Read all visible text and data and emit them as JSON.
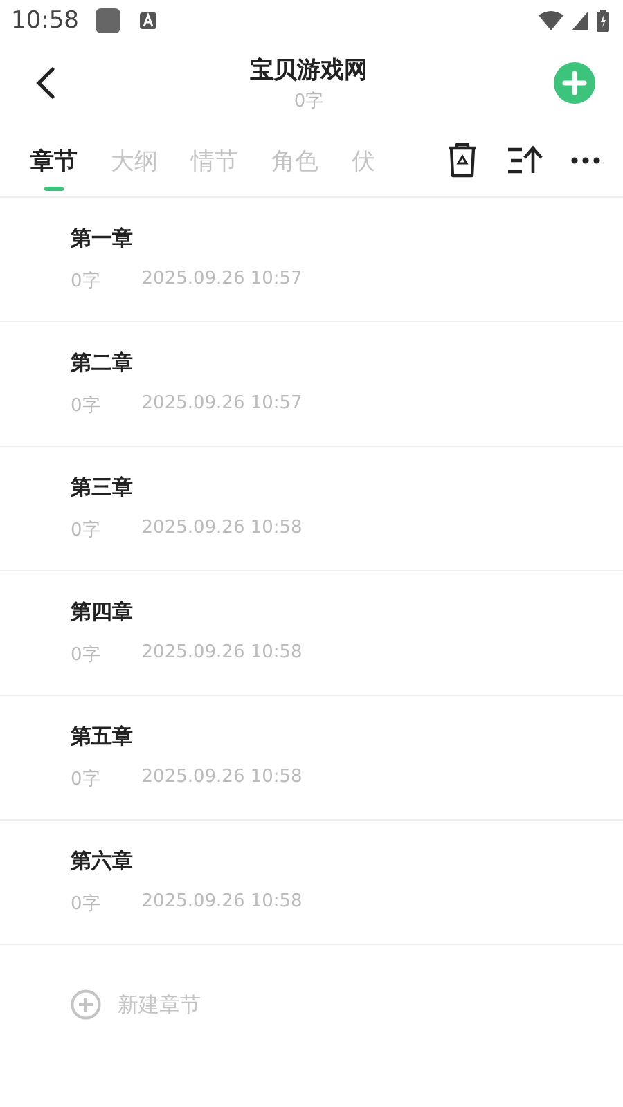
{
  "status_bar": {
    "time": "10:58"
  },
  "header": {
    "title": "宝贝游戏网",
    "subtitle": "0字"
  },
  "tabs": [
    {
      "label": "章节",
      "selected": true
    },
    {
      "label": "大纲",
      "selected": false
    },
    {
      "label": "情节",
      "selected": false
    },
    {
      "label": "角色",
      "selected": false
    },
    {
      "label": "伏",
      "selected": false
    }
  ],
  "chapters": [
    {
      "title": "第一章",
      "words": "0字",
      "date": "2025.09.26 10:57"
    },
    {
      "title": "第二章",
      "words": "0字",
      "date": "2025.09.26 10:57"
    },
    {
      "title": "第三章",
      "words": "0字",
      "date": "2025.09.26 10:58"
    },
    {
      "title": "第四章",
      "words": "0字",
      "date": "2025.09.26 10:58"
    },
    {
      "title": "第五章",
      "words": "0字",
      "date": "2025.09.26 10:58"
    },
    {
      "title": "第六章",
      "words": "0字",
      "date": "2025.09.26 10:58"
    }
  ],
  "new_chapter": {
    "label": "新建章节"
  }
}
